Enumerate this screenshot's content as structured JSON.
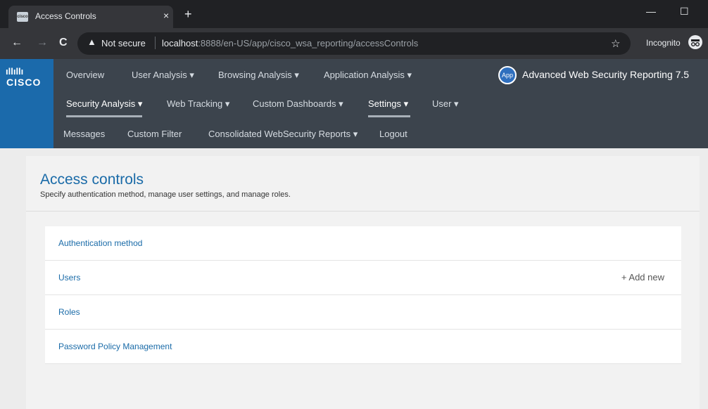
{
  "browser": {
    "tab_title": "Access Controls",
    "tab_close": "×",
    "new_tab": "+",
    "minimize": "—",
    "maximize": "☐",
    "back": "←",
    "forward": "→",
    "reload": "C",
    "warning_icon": "▲",
    "not_secure": "Not secure",
    "url_host": "localhost",
    "url_rest": ":8888/en-US/app/cisco_wsa_reporting/accessControls",
    "bookmark_star": "☆",
    "incognito_label": "Incognito"
  },
  "logo": {
    "bars": "ıllıllı",
    "text": "CISCO"
  },
  "nav": {
    "row1": [
      {
        "label": "Overview"
      },
      {
        "label": "User Analysis ▾"
      },
      {
        "label": "Browsing Analysis ▾"
      },
      {
        "label": "Application Analysis ▾"
      }
    ],
    "row2": [
      {
        "label": "Security Analysis ▾"
      },
      {
        "label": "Web Tracking ▾"
      },
      {
        "label": "Custom Dashboards ▾"
      },
      {
        "label": "Settings ▾"
      },
      {
        "label": "User ▾"
      }
    ],
    "row3": [
      {
        "label": "Messages"
      },
      {
        "label": "Custom Filter"
      },
      {
        "label": "Consolidated WebSecurity Reports ▾"
      },
      {
        "label": "Logout"
      }
    ],
    "app_badge": "App",
    "app_title": "Advanced Web Security Reporting 7.5"
  },
  "page": {
    "title": "Access controls",
    "subtitle": "Specify authentication method, manage user settings, and manage roles."
  },
  "items": [
    {
      "label": "Authentication method",
      "action": ""
    },
    {
      "label": "Users",
      "action": "+ Add new"
    },
    {
      "label": "Roles",
      "action": ""
    },
    {
      "label": "Password Policy Management",
      "action": ""
    }
  ]
}
